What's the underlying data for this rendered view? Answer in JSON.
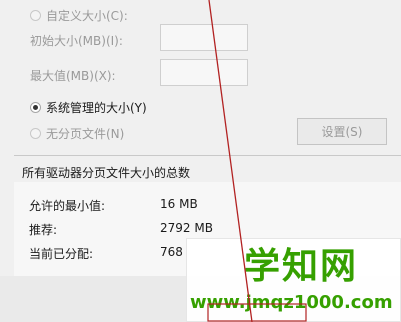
{
  "paging_options": {
    "custom_size_label": "自定义大小(C):",
    "initial_size_label": "初始大小(MB)(I):",
    "max_size_label": "最大值(MB)(X):",
    "system_managed_label": "系统管理的大小(Y)",
    "no_paging_label": "无分页文件(N)",
    "set_button_label": "设置(S)",
    "selected_option": "system_managed"
  },
  "summary": {
    "title": "所有驱动器分页文件大小的总数",
    "rows": [
      {
        "label": "允许的最小值:",
        "value": "16 MB"
      },
      {
        "label": "推荐:",
        "value": "2792 MB"
      },
      {
        "label": "当前已分配:",
        "value": "768"
      }
    ]
  },
  "watermark": {
    "logo_text": "学知网",
    "url_text": "www.jmqz1000.com",
    "color": "#36a000"
  },
  "colors": {
    "annotation_line": "#b22222"
  }
}
